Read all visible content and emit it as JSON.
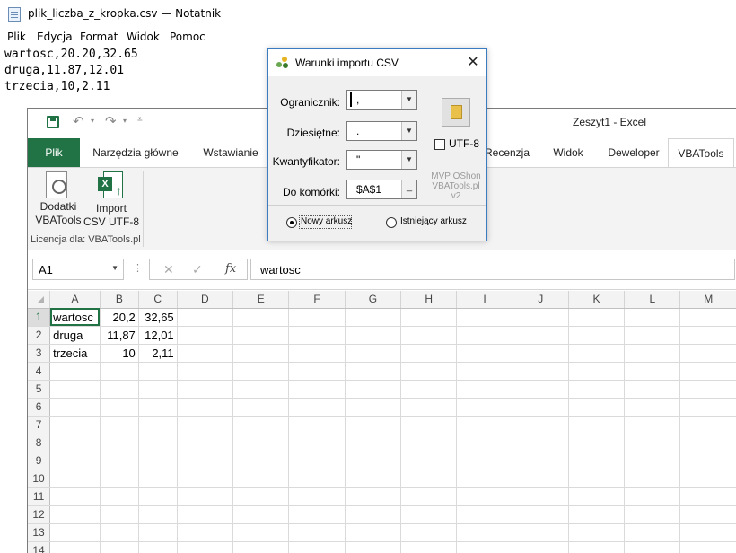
{
  "notepad": {
    "title": "plik_liczba_z_kropka.csv — Notatnik",
    "menu": [
      "Plik",
      "Edycja",
      "Format",
      "Widok",
      "Pomoc"
    ],
    "lines": [
      "wartosc,20.20,32.65",
      "druga,11.87,12.01",
      "trzecia,10,2.11"
    ]
  },
  "excel": {
    "window_title": "Zeszyt1  -  Excel",
    "tabs": [
      "Plik",
      "Narzędzia główne",
      "Wstawianie",
      "Recenzja",
      "Widok",
      "Deweloper",
      "VBATools"
    ],
    "active_tab": "VBATools",
    "ribbon": {
      "dodatki_label": [
        "Dodatki",
        "VBATools"
      ],
      "import_label": [
        "Import",
        "CSV UTF-8"
      ],
      "group_label": "Licencja dla: VBATools.pl"
    },
    "name_box": "A1",
    "formula": "wartosc",
    "columns": [
      "A",
      "B",
      "C",
      "D",
      "E",
      "F",
      "G",
      "H",
      "I",
      "J",
      "K",
      "L",
      "M"
    ],
    "rows": [
      {
        "n": "1",
        "a": "wartosc",
        "b": "20,2",
        "c": "32,65"
      },
      {
        "n": "2",
        "a": "druga",
        "b": "11,87",
        "c": "12,01"
      },
      {
        "n": "3",
        "a": "trzecia",
        "b": "10",
        "c": "2,11"
      },
      {
        "n": "4"
      },
      {
        "n": "5"
      },
      {
        "n": "6"
      },
      {
        "n": "7"
      },
      {
        "n": "8"
      },
      {
        "n": "9"
      },
      {
        "n": "10"
      },
      {
        "n": "11"
      },
      {
        "n": "12"
      },
      {
        "n": "13"
      },
      {
        "n": "14"
      }
    ],
    "accent": "#217346"
  },
  "dialog": {
    "title": "Warunki importu CSV",
    "fields": {
      "ogranicznik": {
        "label": "Ogranicznik:",
        "value": ","
      },
      "dziesietne": {
        "label": "Dziesiętne:",
        "value": "."
      },
      "kwantyfikator": {
        "label": "Kwantyfikator:",
        "value": "\""
      },
      "do_komorki": {
        "label": "Do komórki:",
        "value": "$A$1"
      }
    },
    "utf8_label": "UTF-8",
    "utf8_checked": false,
    "credit": [
      "MVP OShon",
      "VBATools.pl",
      "v2"
    ],
    "radio_new": "Nowy arkusz",
    "radio_existing": "Istniejący arkusz",
    "radio_selected": "new"
  }
}
